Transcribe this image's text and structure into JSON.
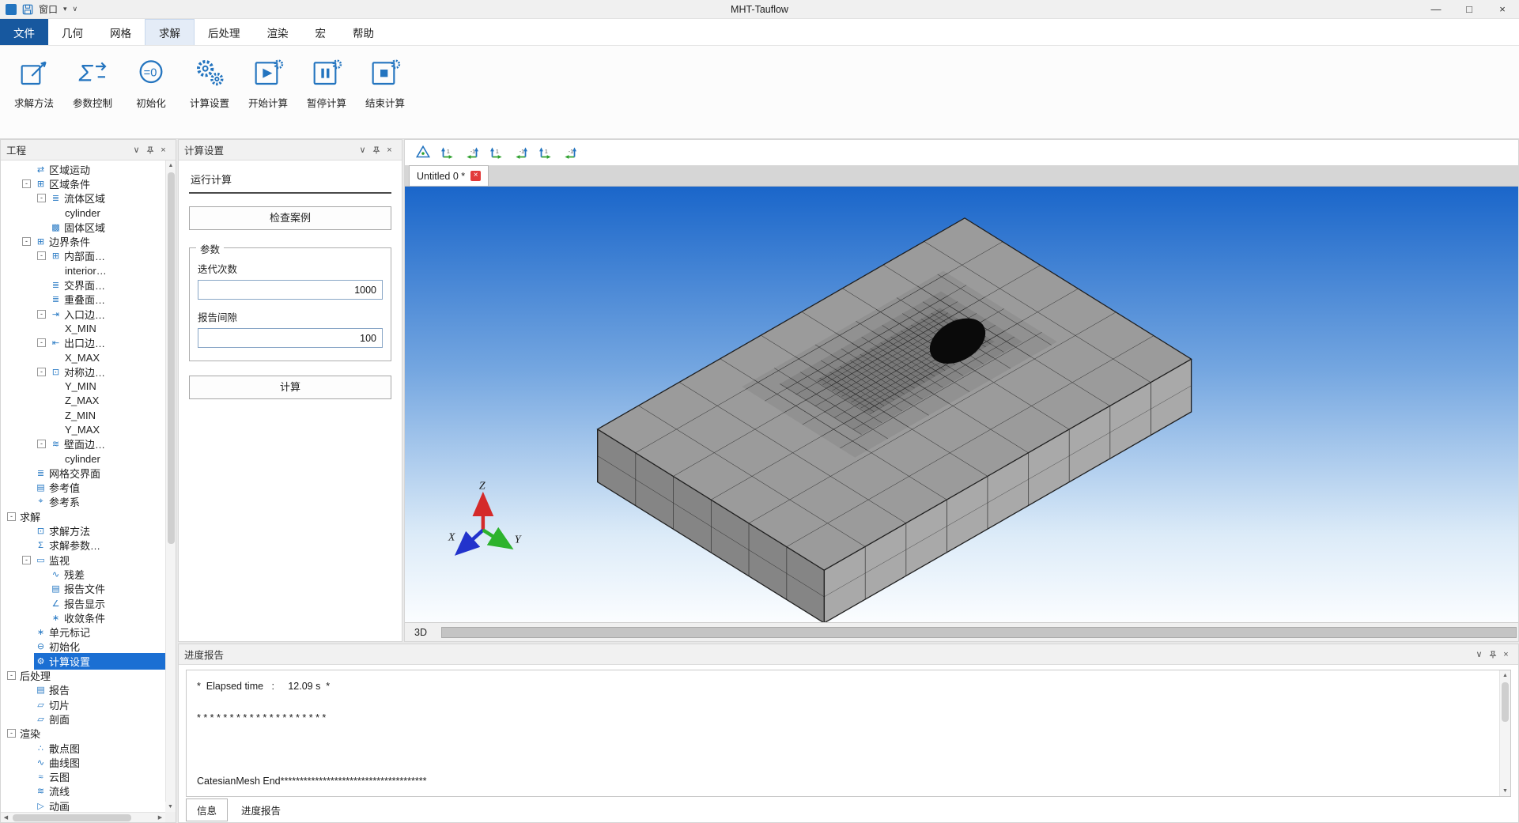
{
  "titlebar": {
    "title": "MHT-Tauflow",
    "quick_label": "窗口"
  },
  "menu": {
    "items": [
      "文件",
      "几何",
      "网格",
      "求解",
      "后处理",
      "渲染",
      "宏",
      "帮助"
    ],
    "active": "求解"
  },
  "ribbon": {
    "buttons": [
      "求解方法",
      "参数控制",
      "初始化",
      "计算设置",
      "开始计算",
      "暂停计算",
      "结束计算"
    ]
  },
  "project": {
    "title": "工程",
    "selected": "计算设置",
    "items": [
      "区域运动",
      "区域条件",
      "流体区域",
      "cylinder",
      "固体区域",
      "边界条件",
      "内部面…",
      "interior…",
      "交界面…",
      "重叠面…",
      "入口边…",
      "X_MIN",
      "出口边…",
      "X_MAX",
      "对称边…",
      "Y_MIN",
      "Z_MAX",
      "Z_MIN",
      "Y_MAX",
      "壁面边…",
      "cylinder",
      "网格交界面",
      "参考值",
      "参考系",
      "求解",
      "求解方法",
      "求解参数…",
      "监视",
      "残差",
      "报告文件",
      "报告显示",
      "收敛条件",
      "单元标记",
      "初始化",
      "计算设置",
      "后处理",
      "报告",
      "切片",
      "剖面",
      "渲染",
      "散点图",
      "曲线图",
      "云图",
      "流线",
      "动画"
    ]
  },
  "settings": {
    "title": "计算设置",
    "section": "运行计算",
    "check_case": "检查案例",
    "params_title": "参数",
    "iter_label": "迭代次数",
    "iter_value": "1000",
    "report_label": "报告间隙",
    "report_value": "100",
    "compute": "计算"
  },
  "viewport": {
    "tab": "Untitled 0 *",
    "mode": "3D",
    "axes": {
      "x": "X",
      "y": "Y",
      "z": "Z"
    }
  },
  "progress": {
    "title": "进度报告",
    "text": "*  Elapsed time   :     12.09 s  *\n\n* * * * * * * * * * * * * * * * * * * *\n\n\n\nCatesianMesh End**************************************",
    "tabs": [
      "信息",
      "进度报告"
    ]
  },
  "colors": {
    "accent": "#2374bf",
    "selection": "#1b6fd3",
    "file_menu": "#17589f",
    "tab_close": "#e23b3b"
  },
  "icons": {
    "minus": "-",
    "chevron_down": "∨",
    "close": "×",
    "caret_down": "▾",
    "win_min": "—",
    "win_max": "□",
    "win_close": "×",
    "arrow_up": "▲",
    "arrow_down": "▼",
    "arrow_left": "◀",
    "arrow_right": "▶",
    "motion": "⇄",
    "grid": "⊞",
    "doc": "≣",
    "solid": "▩",
    "inlet": "⇥",
    "outlet": "⇤",
    "sym": "⊡",
    "wall": "≋",
    "refval": "▤",
    "refframe": "⌖",
    "method": "⊡",
    "sigma": "Σ",
    "monitor": "▭",
    "residual": "∿",
    "angle": "∠",
    "star": "∗",
    "init": "⊖",
    "gear": "⚙",
    "slice": "▱",
    "scatter": "∴",
    "cloud": "≈",
    "anim": "▷"
  }
}
